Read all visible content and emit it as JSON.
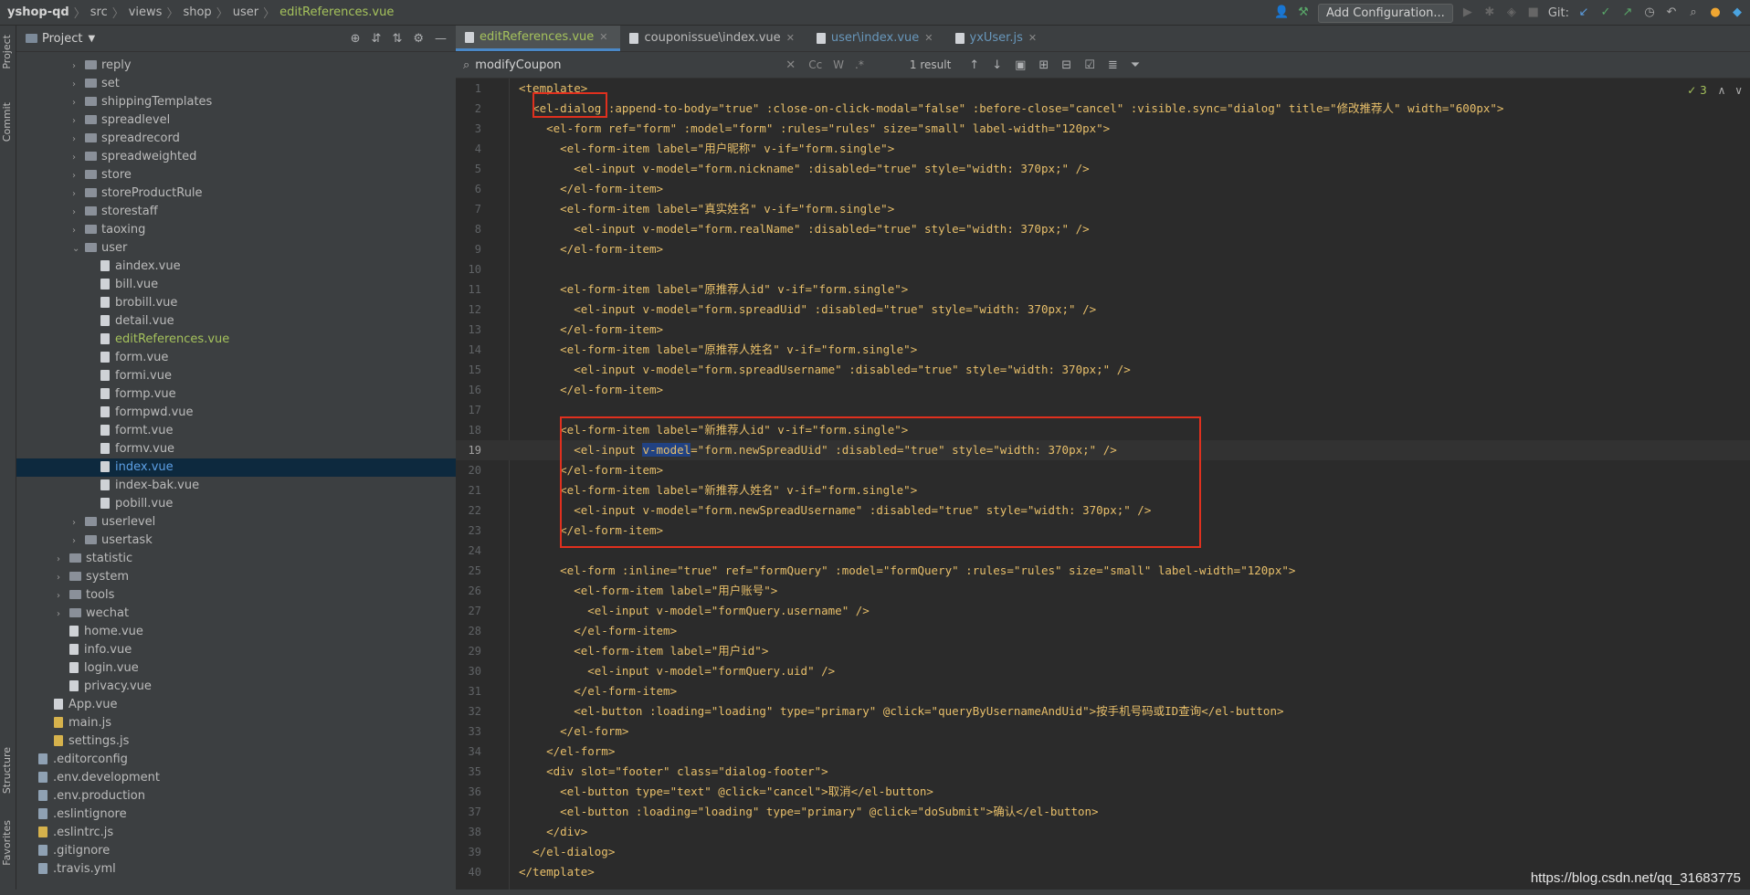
{
  "breadcrumb": {
    "project": "yshop-qd",
    "parts": [
      "src",
      "views",
      "shop",
      "user"
    ],
    "file": "editReferences.vue"
  },
  "toolbar": {
    "add_configuration": "Add Configuration...",
    "git_label": "Git:"
  },
  "left_strip": {
    "project": "Project",
    "commit": "Commit",
    "structure": "Structure",
    "favorites": "Favorites"
  },
  "project_panel": {
    "title": "Project",
    "tree": [
      {
        "label": "reply",
        "type": "folder",
        "depth": 3
      },
      {
        "label": "set",
        "type": "folder",
        "depth": 3
      },
      {
        "label": "shippingTemplates",
        "type": "folder",
        "depth": 3
      },
      {
        "label": "spreadlevel",
        "type": "folder",
        "depth": 3
      },
      {
        "label": "spreadrecord",
        "type": "folder",
        "depth": 3
      },
      {
        "label": "spreadweighted",
        "type": "folder",
        "depth": 3
      },
      {
        "label": "store",
        "type": "folder",
        "depth": 3
      },
      {
        "label": "storeProductRule",
        "type": "folder",
        "depth": 3
      },
      {
        "label": "storestaff",
        "type": "folder",
        "depth": 3
      },
      {
        "label": "taoxing",
        "type": "folder",
        "depth": 3
      },
      {
        "label": "user",
        "type": "folder-open",
        "depth": 3
      },
      {
        "label": "aindex.vue",
        "type": "vue",
        "depth": 4
      },
      {
        "label": "bill.vue",
        "type": "vue",
        "depth": 4
      },
      {
        "label": "brobill.vue",
        "type": "vue",
        "depth": 4
      },
      {
        "label": "detail.vue",
        "type": "vue",
        "depth": 4
      },
      {
        "label": "editReferences.vue",
        "type": "vue",
        "depth": 4,
        "state": "modified"
      },
      {
        "label": "form.vue",
        "type": "vue",
        "depth": 4
      },
      {
        "label": "formi.vue",
        "type": "vue",
        "depth": 4
      },
      {
        "label": "formp.vue",
        "type": "vue",
        "depth": 4
      },
      {
        "label": "formpwd.vue",
        "type": "vue",
        "depth": 4
      },
      {
        "label": "formt.vue",
        "type": "vue",
        "depth": 4
      },
      {
        "label": "formv.vue",
        "type": "vue",
        "depth": 4
      },
      {
        "label": "index.vue",
        "type": "vue",
        "depth": 4,
        "state": "selected"
      },
      {
        "label": "index-bak.vue",
        "type": "vue",
        "depth": 4
      },
      {
        "label": "pobill.vue",
        "type": "vue",
        "depth": 4
      },
      {
        "label": "userlevel",
        "type": "folder",
        "depth": 3
      },
      {
        "label": "usertask",
        "type": "folder",
        "depth": 3
      },
      {
        "label": "statistic",
        "type": "folder",
        "depth": 2
      },
      {
        "label": "system",
        "type": "folder",
        "depth": 2
      },
      {
        "label": "tools",
        "type": "folder",
        "depth": 2
      },
      {
        "label": "wechat",
        "type": "folder",
        "depth": 2
      },
      {
        "label": "home.vue",
        "type": "vue",
        "depth": 2
      },
      {
        "label": "info.vue",
        "type": "vue",
        "depth": 2
      },
      {
        "label": "login.vue",
        "type": "vue",
        "depth": 2
      },
      {
        "label": "privacy.vue",
        "type": "vue",
        "depth": 2
      },
      {
        "label": "App.vue",
        "type": "vue",
        "depth": 1
      },
      {
        "label": "main.js",
        "type": "js",
        "depth": 1
      },
      {
        "label": "settings.js",
        "type": "js",
        "depth": 1
      },
      {
        "label": ".editorconfig",
        "type": "cfg",
        "depth": 0
      },
      {
        "label": ".env.development",
        "type": "cfg",
        "depth": 0
      },
      {
        "label": ".env.production",
        "type": "cfg",
        "depth": 0
      },
      {
        "label": ".eslintignore",
        "type": "cfg",
        "depth": 0
      },
      {
        "label": ".eslintrc.js",
        "type": "js",
        "depth": 0
      },
      {
        "label": ".gitignore",
        "type": "cfg",
        "depth": 0
      },
      {
        "label": ".travis.yml",
        "type": "cfg",
        "depth": 0
      }
    ]
  },
  "tabs": [
    {
      "label": "editReferences.vue",
      "active": true
    },
    {
      "label": "couponissue\\index.vue",
      "active": false
    },
    {
      "label": "user\\index.vue",
      "active": false
    },
    {
      "label": "yxUser.js",
      "active": false
    }
  ],
  "search": {
    "query": "modifyCoupon",
    "result_count": "1 result",
    "opt_cc": "Cc",
    "opt_w": "W"
  },
  "inspection_count": "3",
  "code_lines": [
    "<template>",
    "  <el-dialog :append-to-body=\"true\" :close-on-click-modal=\"false\" :before-close=\"cancel\" :visible.sync=\"dialog\" title=\"修改推荐人\" width=\"600px\">",
    "    <el-form ref=\"form\" :model=\"form\" :rules=\"rules\" size=\"small\" label-width=\"120px\">",
    "      <el-form-item label=\"用户昵称\" v-if=\"form.single\">",
    "        <el-input v-model=\"form.nickname\" :disabled=\"true\" style=\"width: 370px;\" />",
    "      </el-form-item>",
    "      <el-form-item label=\"真实姓名\" v-if=\"form.single\">",
    "        <el-input v-model=\"form.realName\" :disabled=\"true\" style=\"width: 370px;\" />",
    "      </el-form-item>",
    "",
    "      <el-form-item label=\"原推荐人id\" v-if=\"form.single\">",
    "        <el-input v-model=\"form.spreadUid\" :disabled=\"true\" style=\"width: 370px;\" />",
    "      </el-form-item>",
    "      <el-form-item label=\"原推荐人姓名\" v-if=\"form.single\">",
    "        <el-input v-model=\"form.spreadUsername\" :disabled=\"true\" style=\"width: 370px;\" />",
    "      </el-form-item>",
    "",
    "      <el-form-item label=\"新推荐人id\" v-if=\"form.single\">",
    "        <el-input v-model=\"form.newSpreadUid\" :disabled=\"true\" style=\"width: 370px;\" />",
    "      </el-form-item>",
    "      <el-form-item label=\"新推荐人姓名\" v-if=\"form.single\">",
    "        <el-input v-model=\"form.newSpreadUsername\" :disabled=\"true\" style=\"width: 370px;\" />",
    "      </el-form-item>",
    "",
    "      <el-form :inline=\"true\" ref=\"formQuery\" :model=\"formQuery\" :rules=\"rules\" size=\"small\" label-width=\"120px\">",
    "        <el-form-item label=\"用户账号\">",
    "          <el-input v-model=\"formQuery.username\" />",
    "        </el-form-item>",
    "        <el-form-item label=\"用户id\">",
    "          <el-input v-model=\"formQuery.uid\" />",
    "        </el-form-item>",
    "        <el-button :loading=\"loading\" type=\"primary\" @click=\"queryByUsernameAndUid\">按手机号码或ID查询</el-button>",
    "      </el-form>",
    "    </el-form>",
    "    <div slot=\"footer\" class=\"dialog-footer\">",
    "      <el-button type=\"text\" @click=\"cancel\">取消</el-button>",
    "      <el-button :loading=\"loading\" type=\"primary\" @click=\"doSubmit\">确认</el-button>",
    "    </div>",
    "  </el-dialog>",
    "</template>"
  ],
  "current_line": 19,
  "watermark": "https://blog.csdn.net/qq_31683775"
}
